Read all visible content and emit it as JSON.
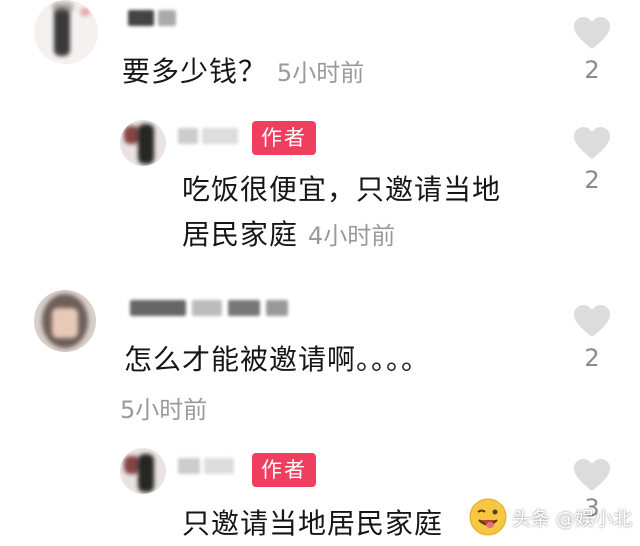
{
  "colors": {
    "author_badge": "#f03e5f",
    "time_text": "#9a9a9a",
    "like_icon": "#dcdcdc"
  },
  "comments": [
    {
      "text": "要多少钱？",
      "time": "5小时前",
      "likes": "2",
      "is_author": false
    },
    {
      "text_line1": "吃饭很便宜，只邀请当地",
      "text_line2": "居民家庭",
      "time": "4小时前",
      "likes": "2",
      "is_author": true,
      "badge": "作者"
    },
    {
      "text": "怎么才能被邀请啊。。。。",
      "time": "5小时前",
      "likes": "2",
      "is_author": false
    },
    {
      "text": "只邀请当地居民家庭",
      "likes": "3",
      "is_author": true,
      "badge": "作者"
    }
  ],
  "watermark": {
    "text": "头条 @娱小北",
    "icon": "winking-face-icon"
  }
}
